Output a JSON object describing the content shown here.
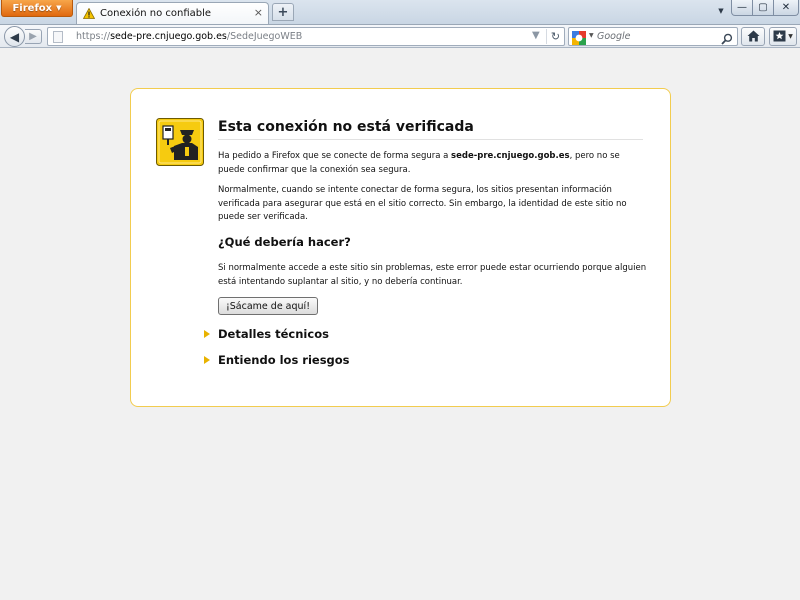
{
  "browser": {
    "app_button_label": "Firefox",
    "tab": {
      "title": "Conexión no confiable"
    },
    "new_tab_label": "+",
    "window_controls": {
      "minimize": "—",
      "maximize": "▢",
      "close": "✕"
    }
  },
  "navbar": {
    "url": {
      "scheme": "https://",
      "host": "sede-pre.cnjuego.gob.es",
      "path": "/SedeJuegoWEB"
    },
    "search": {
      "placeholder": "Google"
    }
  },
  "error_page": {
    "title": "Esta conexión no está verificada",
    "para1_before": "Ha pedido a Firefox que se conecte de forma segura a ",
    "para1_host": "sede-pre.cnjuego.gob.es",
    "para1_after": ", pero no se puede confirmar que la conexión sea segura.",
    "para2": "Normalmente, cuando se intente conectar de forma segura, los sitios presentan información verificada para asegurar que está en el sitio correcto. Sin embargo, la identidad de este sitio no puede ser verificada.",
    "what_heading": "¿Qué debería hacer?",
    "para3": "Si normalmente accede a este sitio sin problemas, este error puede estar ocurriendo porque alguien está intentando suplantar al sitio, y no debería continuar.",
    "button_label": "¡Sácame de aquí!",
    "expander_technical": "Detalles técnicos",
    "expander_risks": "Entiendo los riesgos"
  },
  "colors": {
    "box_border": "#f2cc4f",
    "expander_arrow": "#e8b200",
    "firefox_button": "#e87612"
  }
}
